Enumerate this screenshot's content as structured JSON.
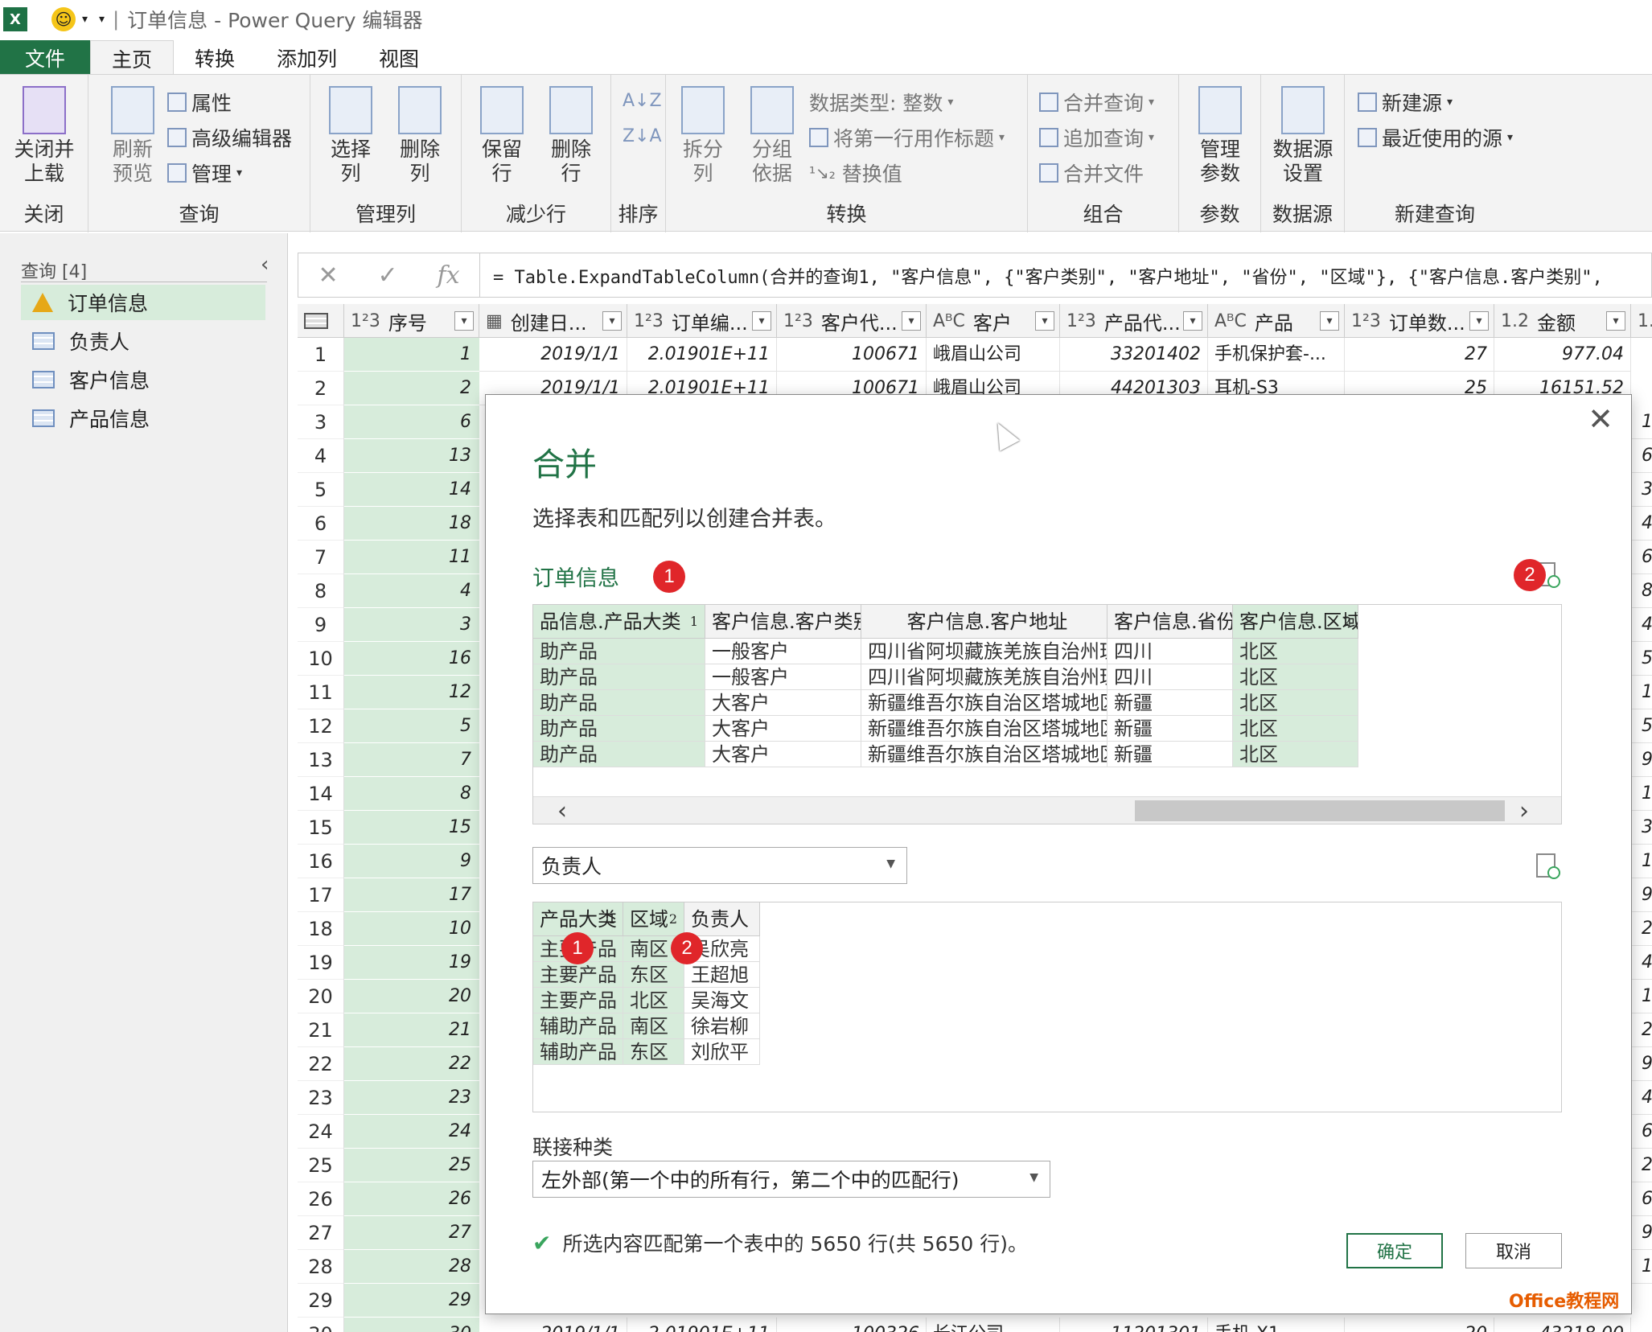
{
  "title_bar": {
    "app_icon": "X",
    "title": "订单信息 - Power Query 编辑器"
  },
  "tabs": [
    "文件",
    "主页",
    "转换",
    "添加列",
    "视图"
  ],
  "ribbon": {
    "close_group": {
      "button": "关闭并\n上载",
      "label": "关闭"
    },
    "query_group": {
      "refresh": "刷新\n预览",
      "properties": "属性",
      "advanced_editor": "高级编辑器",
      "manage": "管理",
      "label": "查询"
    },
    "manage_cols_group": {
      "choose": "选择\n列",
      "remove": "删除\n列",
      "label": "管理列"
    },
    "reduce_rows_group": {
      "keep": "保留\n行",
      "remove": "删除\n行",
      "label": "减少行"
    },
    "sort_group": {
      "label": "排序"
    },
    "transform_group": {
      "split": "拆分\n列",
      "group_by": "分组\n依据",
      "data_type": "数据类型: 整数",
      "first_row_header": "将第一行用作标题",
      "replace": "替换值",
      "label": "转换"
    },
    "combine_group": {
      "merge": "合并查询",
      "append": "追加查询",
      "combine_files": "合并文件",
      "label": "组合"
    },
    "params_group": {
      "manage": "管理\n参数",
      "label": "参数"
    },
    "datasource_group": {
      "settings": "数据源\n设置",
      "label": "数据源"
    },
    "newquery_group": {
      "new_source": "新建源",
      "recent": "最近使用的源",
      "label": "新建查询"
    }
  },
  "queries": {
    "header": "查询 [4]",
    "items": [
      "订单信息",
      "负责人",
      "客户信息",
      "产品信息"
    ]
  },
  "formula": {
    "text": "= Table.ExpandTableColumn(合并的查询1, \"客户信息\", {\"客户类别\", \"客户地址\", \"省份\", \"区域\"}, {\"客户信息.客户类别\","
  },
  "grid": {
    "columns": [
      {
        "type": "1²3",
        "name": "序号"
      },
      {
        "type": "▦",
        "name": "创建日..."
      },
      {
        "type": "1²3",
        "name": "订单编..."
      },
      {
        "type": "1²3",
        "name": "客户代..."
      },
      {
        "type": "AᴮC",
        "name": "客户"
      },
      {
        "type": "1²3",
        "name": "产品代..."
      },
      {
        "type": "AᴮC",
        "name": "产品"
      },
      {
        "type": "1²3",
        "name": "订单数..."
      },
      {
        "type": "1.2",
        "name": "金额"
      },
      {
        "type": "1.2",
        "name": ""
      }
    ],
    "row_numbers": [
      "1",
      "2",
      "3",
      "4",
      "5",
      "6",
      "7",
      "8",
      "9",
      "10",
      "11",
      "12",
      "13",
      "14",
      "15",
      "16",
      "17",
      "18",
      "19",
      "20",
      "21",
      "22",
      "23",
      "24",
      "25",
      "26",
      "27",
      "28",
      "29",
      "30"
    ],
    "seq_values": [
      "1",
      "2",
      "6",
      "13",
      "14",
      "18",
      "11",
      "4",
      "3",
      "16",
      "12",
      "5",
      "7",
      "8",
      "15",
      "9",
      "17",
      "10",
      "19",
      "20",
      "21",
      "22",
      "23",
      "24",
      "25",
      "26",
      "27",
      "28",
      "29",
      "30"
    ],
    "row1": [
      "2019/1/1",
      "2.01901E+11",
      "100671",
      "峨眉山公司",
      "33201402",
      "手机保护套-...",
      "27",
      "977.04"
    ],
    "row2": [
      "2019/1/1",
      "2.01901E+11",
      "100671",
      "峨眉山公司",
      "44201303",
      "耳机-S3",
      "25",
      "16151.52"
    ],
    "row30": [
      "2019/1/1",
      "2.01901E+11",
      "100326",
      "长江公司",
      "11201301",
      "手机-X1",
      "20",
      "43218.00"
    ],
    "right_edge_digits": [
      "1",
      "6",
      "3",
      "4",
      "6",
      "8",
      "4",
      "5",
      "1",
      "5",
      "9",
      "1",
      "3",
      "1",
      "9",
      "2",
      "4",
      "1",
      "2",
      "9",
      "4",
      "6",
      "2",
      "6",
      "9",
      "1"
    ]
  },
  "dialog": {
    "close": "✕",
    "title": "合并",
    "subtitle": "选择表和匹配列以创建合并表。",
    "table1_name": "订单信息",
    "table1": {
      "headers": [
        "品信息.产品大类",
        "客户信息.客户类别",
        "客户信息.客户地址",
        "客户信息.省份",
        "客户信息.区域"
      ],
      "key_nums": [
        "1",
        "",
        "",
        "",
        "2"
      ],
      "rows": [
        [
          "助产品",
          "一般客户",
          "四川省阿坝藏族羌族自治州理县",
          "四川",
          "北区"
        ],
        [
          "助产品",
          "一般客户",
          "四川省阿坝藏族羌族自治州理县",
          "四川",
          "北区"
        ],
        [
          "助产品",
          "大客户",
          "新疆维吾尔族自治区塔城地区沙湾县",
          "新疆",
          "北区"
        ],
        [
          "助产品",
          "大客户",
          "新疆维吾尔族自治区塔城地区沙湾县",
          "新疆",
          "北区"
        ],
        [
          "助产品",
          "大客户",
          "新疆维吾尔族自治区塔城地区沙湾县",
          "新疆",
          "北区"
        ]
      ]
    },
    "table2_select": "负责人",
    "table2": {
      "headers": [
        "产品大类",
        "区域",
        "负责人"
      ],
      "key_nums": [
        "1",
        "2",
        ""
      ],
      "rows": [
        [
          "主要产品",
          "南区",
          "吴欣亮"
        ],
        [
          "主要产品",
          "东区",
          "王超旭"
        ],
        [
          "主要产品",
          "北区",
          "吴海文"
        ],
        [
          "辅助产品",
          "南区",
          "徐岩柳"
        ],
        [
          "辅助产品",
          "东区",
          "刘欣平"
        ]
      ]
    },
    "badges": [
      "1",
      "2"
    ],
    "join_label": "联接种类",
    "join_value": "左外部(第一个中的所有行，第二个中的匹配行)",
    "status": "所选内容匹配第一个表中的 5650 行(共 5650 行)。",
    "ok": "确定",
    "cancel": "取消"
  },
  "watermark": "Office教程网"
}
